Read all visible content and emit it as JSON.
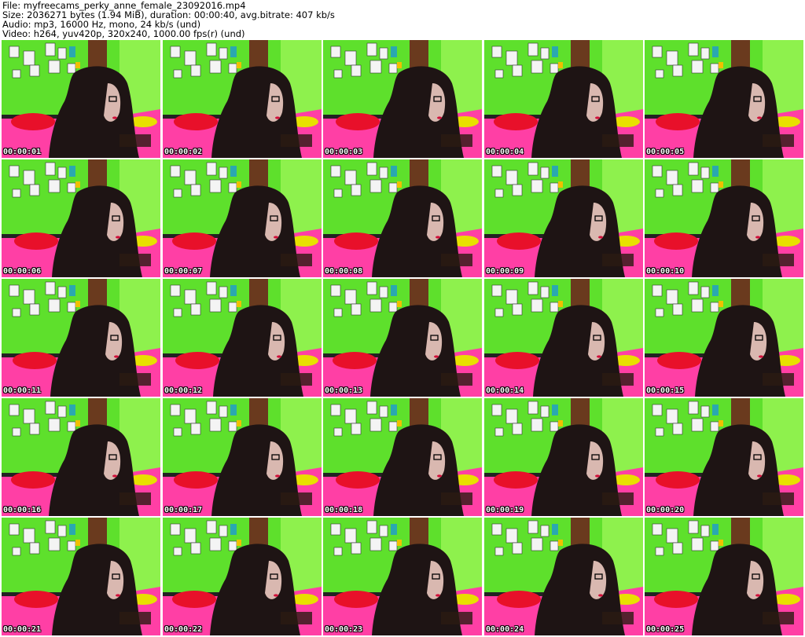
{
  "info": {
    "line1": "File: myfreecams_perky_anne_female_23092016.mp4",
    "line2": "Size: 2036271 bytes (1.94 MiB), duration: 00:00:40, avg.bitrate: 407 kb/s",
    "line3": "Audio: mp3, 16000 Hz, mono, 24 kb/s (und)",
    "line4": "Video: h264, yuv420p, 320x240, 1000.00 fps(r) (und)"
  },
  "thumbnails": [
    {
      "timestamp": "00:00:01"
    },
    {
      "timestamp": "00:00:02"
    },
    {
      "timestamp": "00:00:03"
    },
    {
      "timestamp": "00:00:04"
    },
    {
      "timestamp": "00:00:05"
    },
    {
      "timestamp": "00:00:06"
    },
    {
      "timestamp": "00:00:07"
    },
    {
      "timestamp": "00:00:08"
    },
    {
      "timestamp": "00:00:09"
    },
    {
      "timestamp": "00:00:10"
    },
    {
      "timestamp": "00:00:11"
    },
    {
      "timestamp": "00:00:12"
    },
    {
      "timestamp": "00:00:13"
    },
    {
      "timestamp": "00:00:14"
    },
    {
      "timestamp": "00:00:15"
    },
    {
      "timestamp": "00:00:16"
    },
    {
      "timestamp": "00:00:17"
    },
    {
      "timestamp": "00:00:18"
    },
    {
      "timestamp": "00:00:19"
    },
    {
      "timestamp": "00:00:20"
    },
    {
      "timestamp": "00:00:21"
    },
    {
      "timestamp": "00:00:22"
    },
    {
      "timestamp": "00:00:23"
    },
    {
      "timestamp": "00:00:24"
    },
    {
      "timestamp": "00:00:25"
    }
  ],
  "colors": {
    "wall": "#5ee02c",
    "wall_bright": "#b6ff6a",
    "door": "#6a3a1e",
    "bed": "#ff3fa5",
    "pillow": "#e8102a",
    "pillow_yellow": "#e8e000",
    "hair": "#1e1414",
    "skin": "#d9b8b0"
  }
}
